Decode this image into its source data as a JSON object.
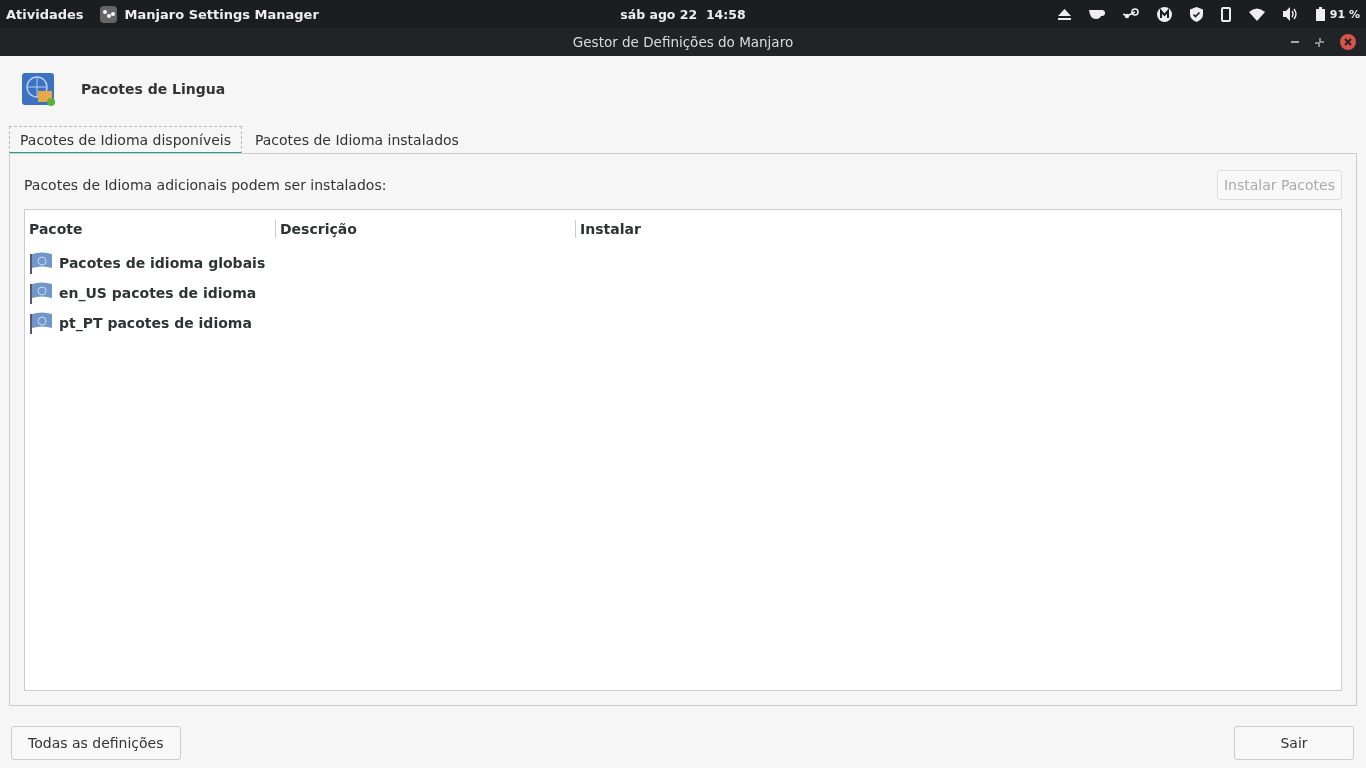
{
  "top_bar": {
    "activities": "Atividades",
    "app_name": "Manjaro Settings Manager",
    "clock": "sáb ago 22  14:58",
    "battery": "91 %"
  },
  "window": {
    "title": "Gestor de Definições do Manjaro"
  },
  "module": {
    "title": "Pacotes de Lingua"
  },
  "tabs": [
    {
      "label": "Pacotes de Idioma disponíveis",
      "selected": true
    },
    {
      "label": "Pacotes de Idioma instalados",
      "selected": false
    }
  ],
  "panel": {
    "description": "Pacotes de Idioma adicionais podem ser instalados:",
    "install_button": {
      "label": "Instalar Pacotes",
      "disabled": true
    }
  },
  "table": {
    "columns": [
      "Pacote",
      "Descrição",
      "Instalar"
    ],
    "rows": [
      {
        "package": "Pacotes de idioma globais"
      },
      {
        "package": "en_US pacotes de idioma"
      },
      {
        "package": "pt_PT pacotes de idioma"
      }
    ]
  },
  "buttons": [
    {
      "label": "Todas as definições"
    },
    {
      "label": "Sair"
    }
  ]
}
